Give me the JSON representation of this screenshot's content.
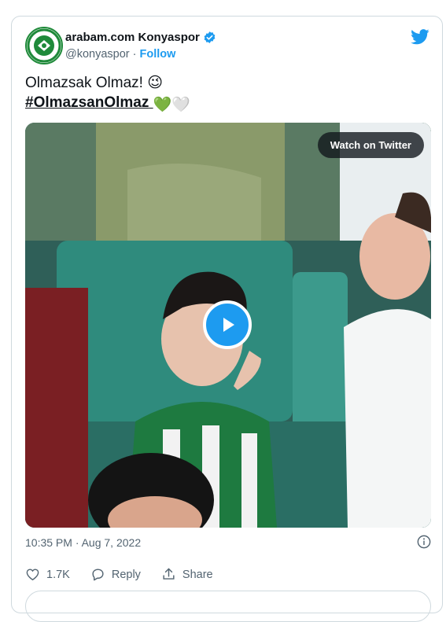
{
  "tweet": {
    "author_name": "arabam.com Konyaspor",
    "handle": "@konyaspor",
    "separator": "·",
    "follow_label": "Follow",
    "line1": "Olmazsak Olmaz! 😉",
    "hashtag": "#OlmazsanOlmaz",
    "hashtag_emojis": "💚🤍",
    "timestamp": "10:35 PM · Aug 7, 2022"
  },
  "media": {
    "watch_label": "Watch on Twitter"
  },
  "actions": {
    "likes": "1.7K",
    "reply_label": "Reply",
    "share_label": "Share"
  },
  "colors": {
    "accent": "#1d9bf0",
    "brand_green": "#1f8a3a",
    "muted": "#536471"
  }
}
